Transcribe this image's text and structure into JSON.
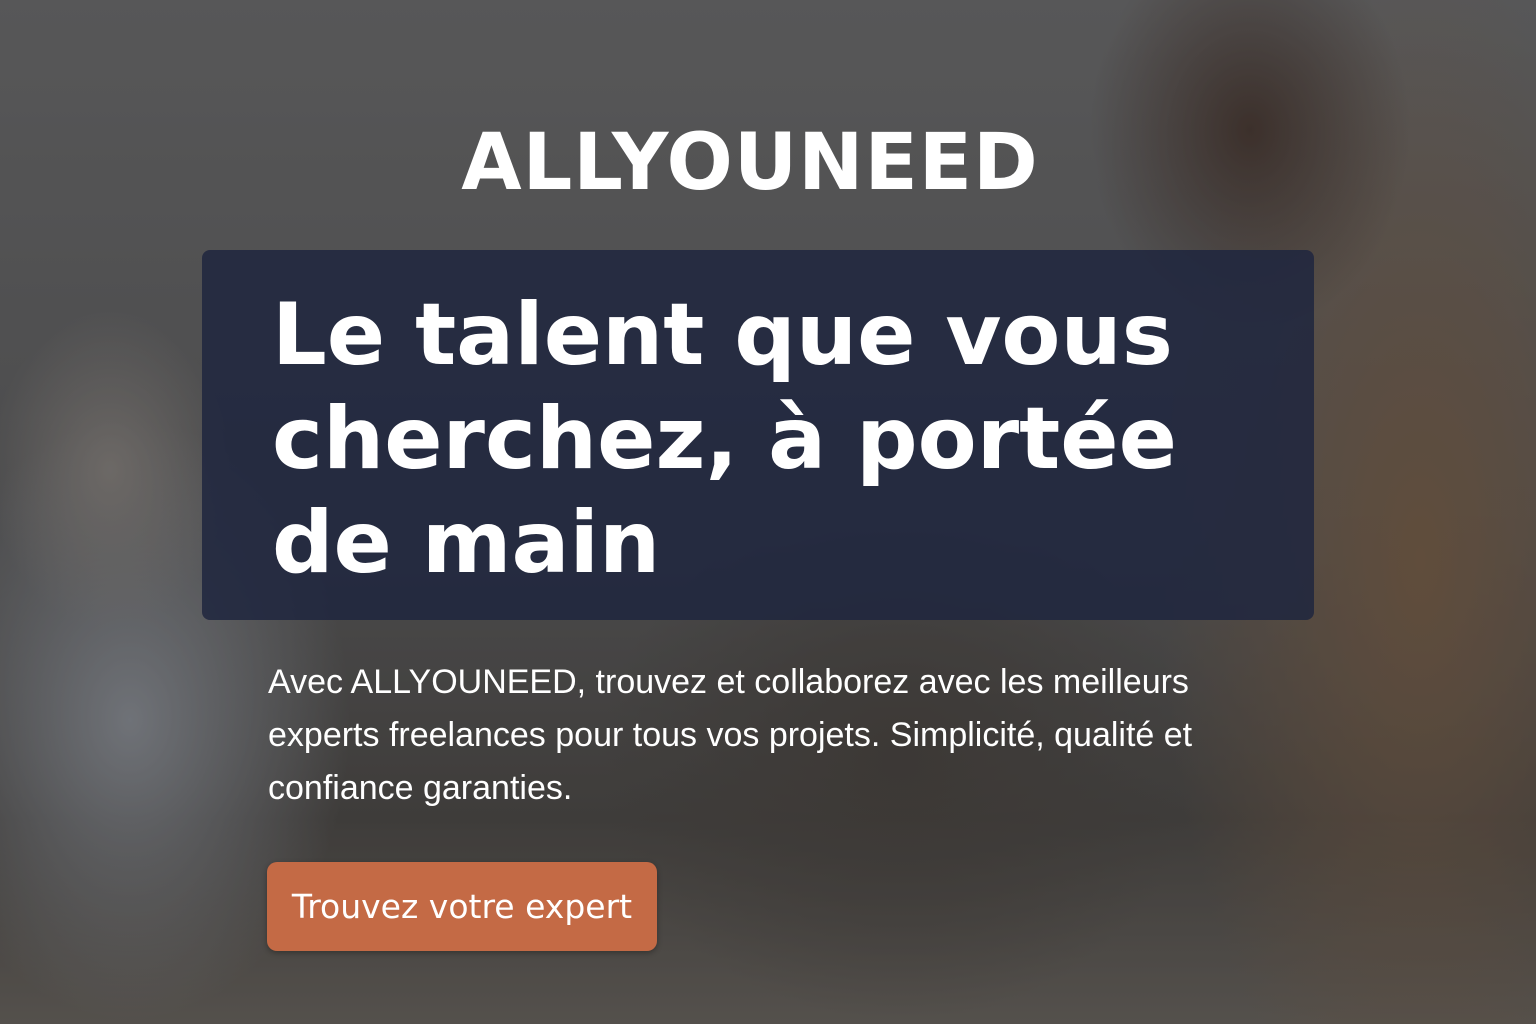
{
  "brand": {
    "logo_text": "ALLYOUNEED"
  },
  "hero": {
    "headline": "Le talent que vous cherchez, à portée de main",
    "subtitle": "Avec ALLYOUNEED, trouvez et collaborez avec les meilleurs experts freelances pour tous vos projets. Simplicité, qualité et confiance garanties.",
    "cta_label": "Trouvez votre expert"
  },
  "colors": {
    "accent": "#c46a45",
    "panel": "#1e263e"
  }
}
